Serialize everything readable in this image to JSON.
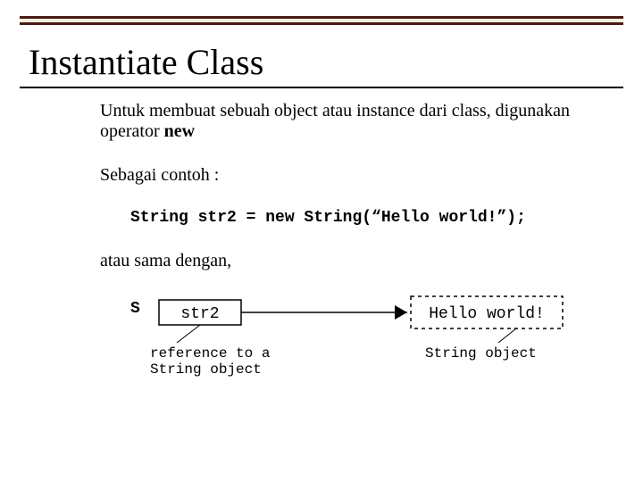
{
  "title": "Instantiate Class",
  "para1_a": "Untuk membuat sebuah object atau instance dari class, digunakan operator ",
  "para1_b": "new",
  "para2": "Sebagai contoh :",
  "code1": "String str2 = new String(“Hello world!”);",
  "para3": "atau sama dengan,",
  "s_letter": "S",
  "diagram": {
    "box_left": "str2",
    "box_right": "Hello world!",
    "label_left": "reference to a\nString object",
    "label_right": "String object"
  }
}
